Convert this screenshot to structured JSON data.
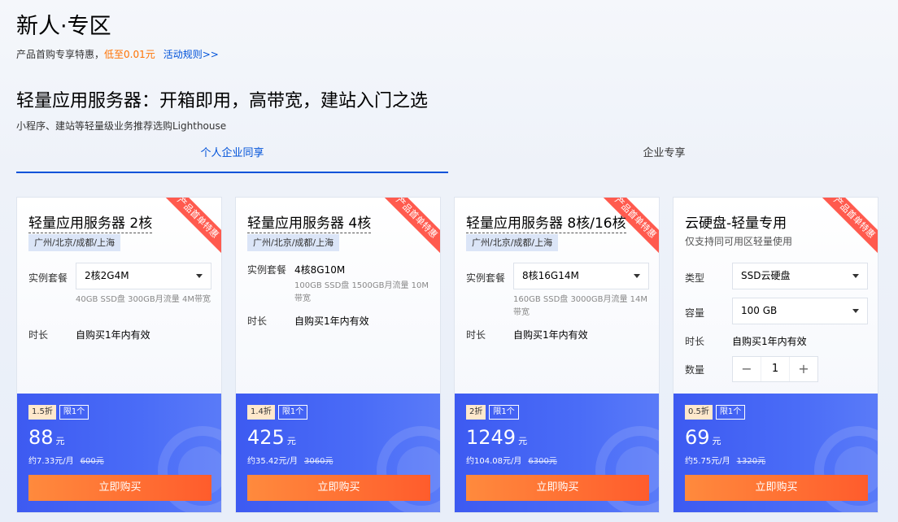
{
  "header": {
    "title": "新人·专区",
    "sub_text": "产品首购专享特惠，",
    "sub_highlight": "低至0.01元",
    "rules_link": "活动规则>>"
  },
  "section": {
    "title": "轻量应用服务器：开箱即用，高带宽，建站入门之选",
    "subtitle": "小程序、建站等轻量级业务推荐选购Lighthouse"
  },
  "tabs": [
    {
      "label": "个人企业同享",
      "active": true
    },
    {
      "label": "企业专享",
      "active": false
    }
  ],
  "ribbon_text": "产品首单特惠",
  "cards": [
    {
      "title": "轻量应用服务器 2核",
      "region": "广州/北京/成都/上海",
      "instance_label": "实例套餐",
      "instance_value": "2核2G4M",
      "spec": "40GB SSD盘 300GB月流量 4M带宽",
      "duration_label": "时长",
      "duration_value": "自购买1年内有效",
      "discount": "1.5折",
      "limit": "限1个",
      "price": "88",
      "price_unit": "元",
      "monthly": "约7.33元/月",
      "original": "600元",
      "buy": "立即购买"
    },
    {
      "title": "轻量应用服务器 4核",
      "region": "广州/北京/成都/上海",
      "instance_label": "实例套餐",
      "instance_value": "4核8G10M",
      "spec": "100GB SSD盘 1500GB月流量 10M带宽",
      "duration_label": "时长",
      "duration_value": "自购买1年内有效",
      "discount": "1.4折",
      "limit": "限1个",
      "price": "425",
      "price_unit": "元",
      "monthly": "约35.42元/月",
      "original": "3060元",
      "buy": "立即购买"
    },
    {
      "title": "轻量应用服务器 8核/16核",
      "region": "广州/北京/成都/上海",
      "instance_label": "实例套餐",
      "instance_value": "8核16G14M",
      "spec": "160GB SSD盘 3000GB月流量 14M带宽",
      "duration_label": "时长",
      "duration_value": "自购买1年内有效",
      "discount": "2折",
      "limit": "限1个",
      "price": "1249",
      "price_unit": "元",
      "monthly": "约104.08元/月",
      "original": "6300元",
      "buy": "立即购买"
    },
    {
      "title": "云硬盘-轻量专用",
      "desc": "仅支持同可用区轻量使用",
      "type_label": "类型",
      "type_value": "SSD云硬盘",
      "capacity_label": "容量",
      "capacity_value": "100 GB",
      "duration_label": "时长",
      "duration_value": "自购买1年内有效",
      "qty_label": "数量",
      "qty_minus": "−",
      "qty_value": "1",
      "qty_plus": "+",
      "discount": "0.5折",
      "limit": "限1个",
      "price": "69",
      "price_unit": "元",
      "monthly": "约5.75元/月",
      "original": "1320元",
      "buy": "立即购买"
    }
  ]
}
